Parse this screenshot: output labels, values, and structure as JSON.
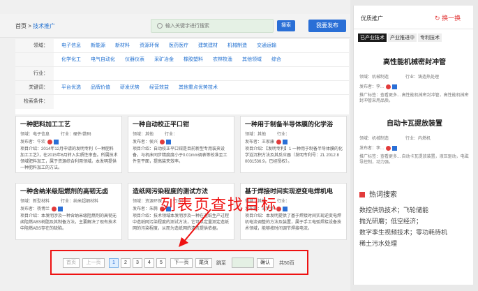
{
  "header": {
    "breadcrumb_home": "首页",
    "breadcrumb_sep": " > ",
    "breadcrumb_current": "技术推广",
    "search_placeholder": "输入关键字进行搜索",
    "search_button": "搜索",
    "publish_button": "我要发布"
  },
  "filters": [
    {
      "label": "领域：",
      "options": [
        "电子信息",
        "新能源",
        "新材料",
        "资源环保",
        "医药医疗",
        "建筑建材",
        "机械制造",
        "交通运输"
      ]
    },
    {
      "label": "",
      "options": [
        "化学化工",
        "电气自动化",
        "仪器仪表",
        "采矿冶金",
        "橡胶塑料",
        "农林牧渔",
        "其他领域",
        "综合"
      ]
    },
    {
      "label": "行业：",
      "options": []
    },
    {
      "label": "关键词：",
      "options": [
        "平台优选",
        "品牌价值",
        "研发优势",
        "经营效益",
        "其他重点优势技术"
      ]
    },
    {
      "label": "检索条件：",
      "options": []
    }
  ],
  "cards": [
    {
      "title": "一种肥料加工工艺",
      "field": "领域：电子信息",
      "industry": "行业：硬件/数码",
      "publisher": "发布者：牛欢",
      "desc": "项目介绍：2014年12月申请的发明专利《一种肥料加工工艺》，在2015年6月转入实质性审查。所属技术领域肥料加工，属于资源综合利用领域。本发明提供一种肥料加工的方法。"
    },
    {
      "title": "一种自动校正平口钳",
      "field": "领域：其他",
      "industry": "行业：",
      "publisher": "发布者：侯兴",
      "desc": "项目介绍：自动校正平口钳是目前新型专用装夹设备，与机床同步精度度小于0.01mm调表等校准至工件至平面，提高装夹效率。"
    },
    {
      "title": "一种用于制备半导体膜的化学浴",
      "field": "领域：其他",
      "industry": "行业：",
      "publisher": "发布者：王家康",
      "desc": "项目介绍：【发明专利】1 一种用于制备半导体膜的化学浴沉积方法及其反应器（发明专利号：ZL 2012 8 0031536.9，已经授权）。"
    },
    {
      "title": "一种含纳米级阻燃剂的高韧无卤",
      "field": "领域：新型材料",
      "industry": "行业：纳米超细材料",
      "publisher": "发布者：杨博兰",
      "desc": "项目介绍：本发明涉及一种含纳米级阻燃剂的高韧无卤阻燃ABS树脂及其制备方法，主要解决了现有技术中阻燃ABS存在的缺陷。"
    },
    {
      "title": "造纸网污染程度的测试方法",
      "field": "领域：资源环保",
      "industry": "行业：",
      "publisher": "发布者：朱腾",
      "desc": "项目介绍：技术领域本发明涉及一种在造纸生产过程中造纸网污染程度的测试方法，它可以定量测定造纸网的污染程度，从而为造纸网的清洗提供依据。"
    },
    {
      "title": "基于焊接时间实现逆变电焊机电",
      "field": "领域：其他",
      "industry": "行业：",
      "publisher": "发布者：王梦华",
      "desc": "项目介绍：本发明提供了基于焊接时间实现逆变电焊机电流调整的方法及装置，属于手工电弧焊接设备技术领域，能够按时间调节焊接电流。"
    }
  ],
  "pager": {
    "first": "首页",
    "prev": "上一页",
    "pages": [
      "1",
      "2",
      "3",
      "4",
      "5"
    ],
    "active_page": "1",
    "next": "下一页",
    "last": "尾页",
    "goto_label": "跳至",
    "confirm": "确认",
    "total": "共50页"
  },
  "overlay_text": "列表页查找目标",
  "sidebar": {
    "title": "优质推广",
    "change": "换一换",
    "tabs": [
      "已产业技术",
      "产业推进中",
      "专利技术"
    ],
    "items": [
      {
        "title": "高性能机械密封冲管",
        "field": "领域：机械制造",
        "industry": "行业：铸造热处理",
        "publisher": "发布者：李...",
        "desc": "推广标签：查看更多... 高性能机械密封冲管，高性能机械密封冲管采用品质。"
      },
      {
        "title": "自动卡瓦提放装置",
        "field": "领域：机械制造",
        "industry": "行业：内燃机",
        "publisher": "发布者：李...",
        "desc": "推广标签：查看更多... 自动卡瓦提放装置，液压驱动，电磁导控制，动力强。"
      }
    ],
    "hot_title": "热词搜索",
    "hot_lines": [
      "数控供热技术；飞轮储能",
      "抛光研磨；低空经济；",
      "数字孪生视频技术；零功耗待机",
      "稀土污水处理"
    ]
  }
}
